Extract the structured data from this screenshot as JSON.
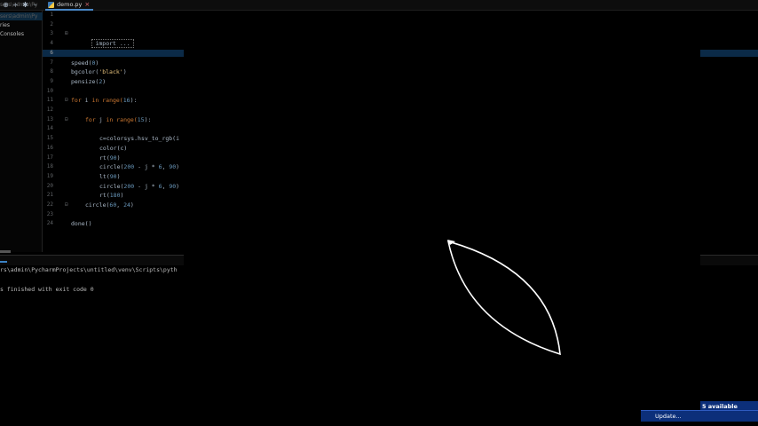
{
  "tabs": {
    "project_fragment": "Py",
    "editor_tab_label": "demo.py"
  },
  "project": {
    "path_fragment": "sers\\admin\\Py",
    "rows": [
      "ries",
      " Consoles"
    ]
  },
  "editor": {
    "line_numbers": [
      "1",
      "2",
      "3",
      "4",
      "5",
      "6",
      "7",
      "8",
      "9",
      "10",
      "11",
      "12",
      "13",
      "14",
      "15",
      "16",
      "17",
      "18",
      "19",
      "20",
      "21",
      "22",
      "23",
      "24"
    ],
    "import_folded": "import ..."
  },
  "code": {
    "l7_speed": "speed",
    "l7_arg": "0",
    "l8_bgcolor": "bgcolor(",
    "l8_arg": "'black'",
    "l8_close": ")",
    "l9_pensize": "pensize(",
    "l9_arg": "2",
    "l9_close": ")",
    "l11_for": "for",
    "l11_i": " i ",
    "l11_in": "in",
    "l11_range": " range(",
    "l11_arg": "16",
    "l11_close": "):",
    "l13_for": "for",
    "l13_j": " j ",
    "l13_in": "in",
    "l13_range": " range(",
    "l13_arg": "15",
    "l13_close": "):",
    "l15": "c=colorsys.hsv_to_rgb(i",
    "l16": "color(c)",
    "l17_rt": "rt(",
    "l17_arg": "90",
    "l17_close": ")",
    "l18_circle": "circle(",
    "l18_a": "200",
    "l18_mid": " - j * ",
    "l18_b": "6",
    "l18_comma": ", ",
    "l18_c": "90",
    "l18_close": ")",
    "l19_lt": "lt(",
    "l19_arg": "90",
    "l19_close": ")",
    "l20_circle": "circle(",
    "l20_a": "200",
    "l20_mid": " - j * ",
    "l20_b": "6",
    "l20_comma": ", ",
    "l20_c": "90",
    "l20_close": ")",
    "l21_rt": "rt(",
    "l21_arg": "180",
    "l21_close": ")",
    "l22_circle": "circle(",
    "l22_a": "60",
    "l22_comma": ", ",
    "l22_b": "24",
    "l22_close": ")",
    "l24": "done()"
  },
  "run": {
    "path_line": "rs\\admin\\PycharmProjects\\untitled\\venv\\Scripts\\pyth",
    "exit_line": "s finished with exit code 0"
  },
  "turtle": {
    "stroke_color": "#ffffff",
    "background": "#000000"
  },
  "notification": {
    "title": "5 available",
    "button_label": "Update..."
  }
}
